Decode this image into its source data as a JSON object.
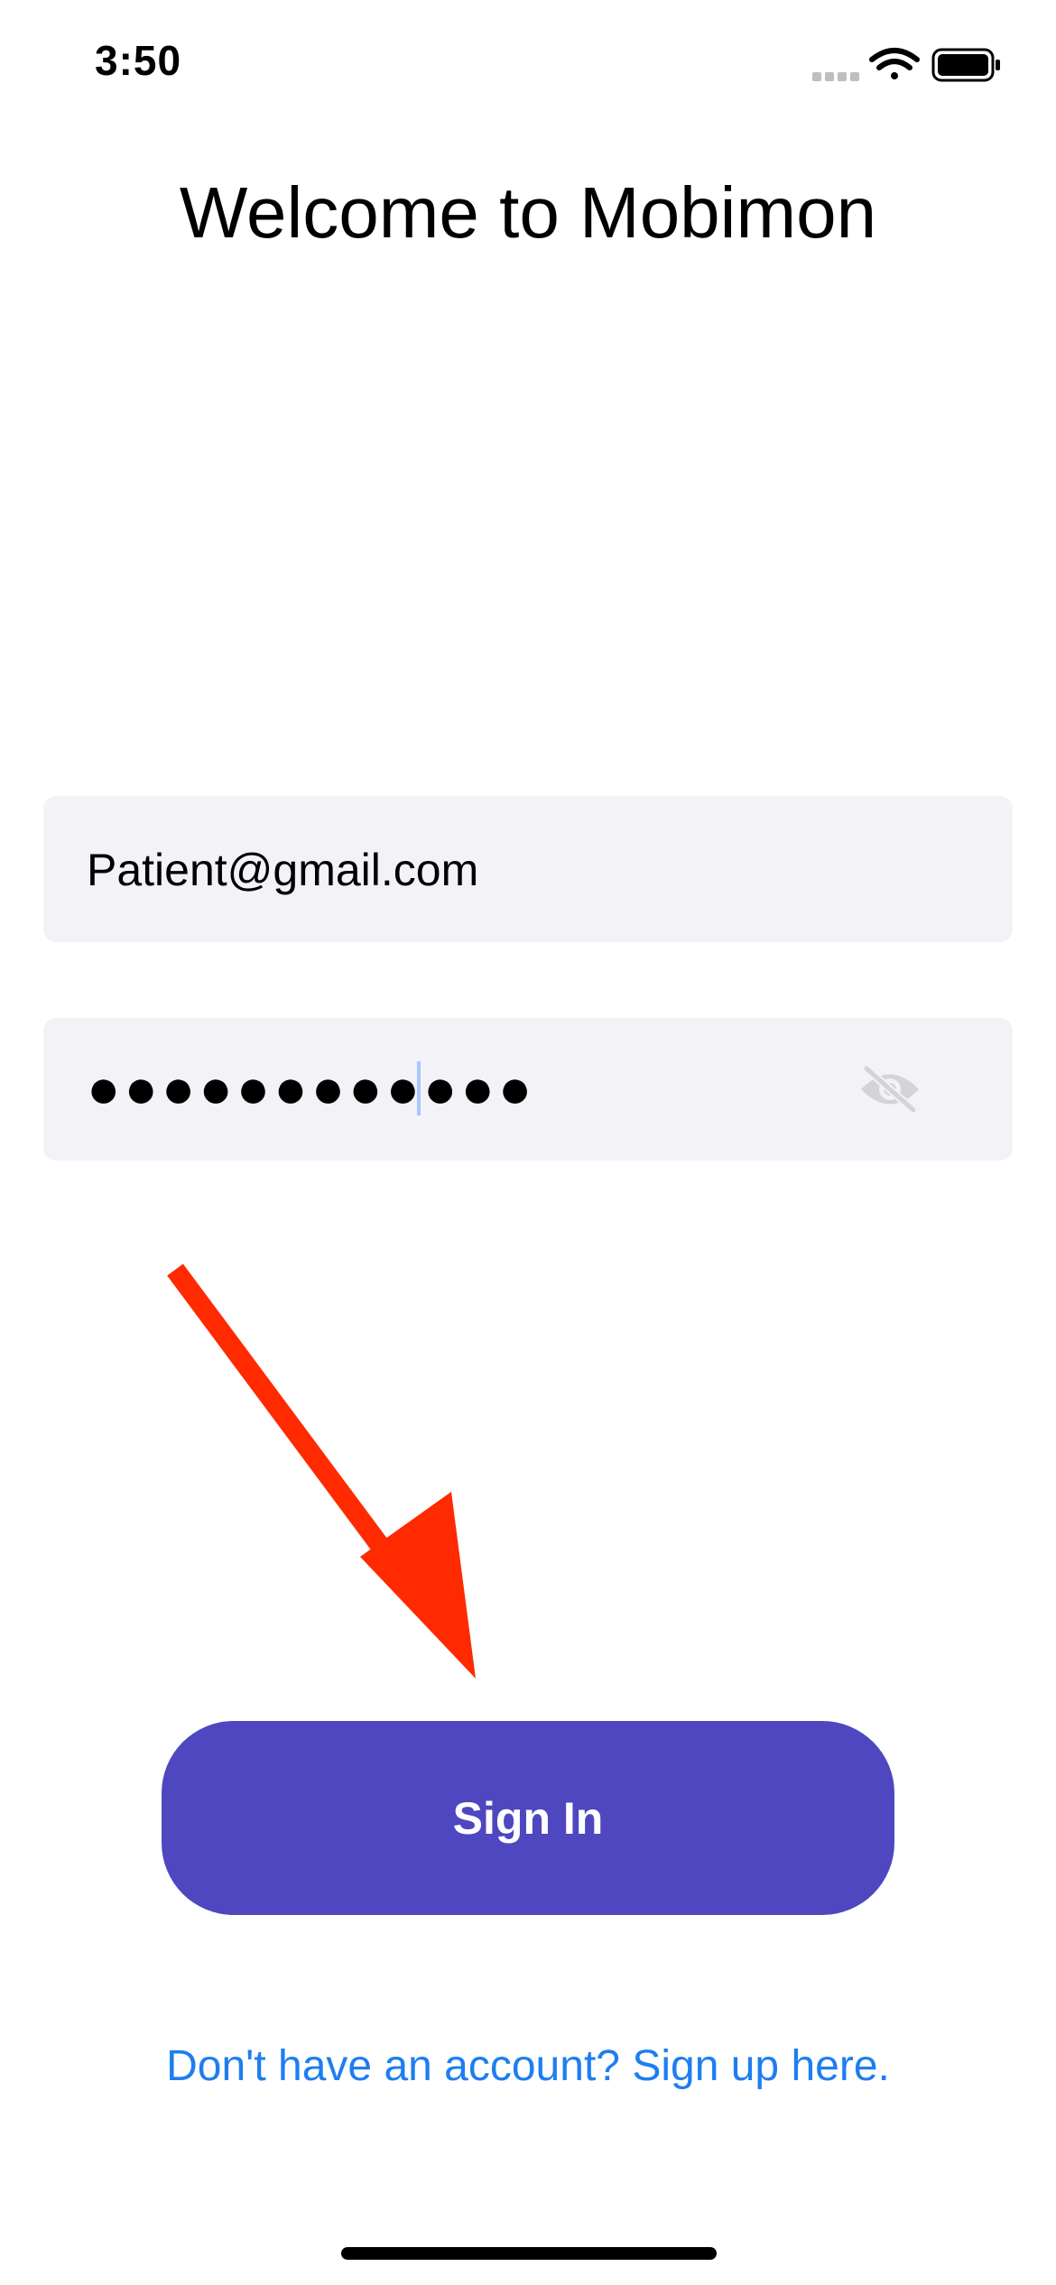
{
  "status_bar": {
    "time": "3:50",
    "icons": [
      "cellular-signal-icon",
      "wifi-icon",
      "battery-icon"
    ]
  },
  "screen": {
    "title": "Welcome to Mobimon"
  },
  "form": {
    "email_value": "Patient@gmail.com",
    "password_masked": "●●●●●●●●●●●●",
    "password_toggle_icon": "eye-slash-icon"
  },
  "actions": {
    "signin_label": "Sign In",
    "signup_link_text": "Don't have an account? Sign up here."
  },
  "annotation": {
    "arrow_color": "#ff2a00",
    "arrow_target": "sign-in-button"
  },
  "colors": {
    "primary_button": "#4e47c0",
    "link": "#1e7ef0",
    "field_background": "#f2f2f7"
  }
}
